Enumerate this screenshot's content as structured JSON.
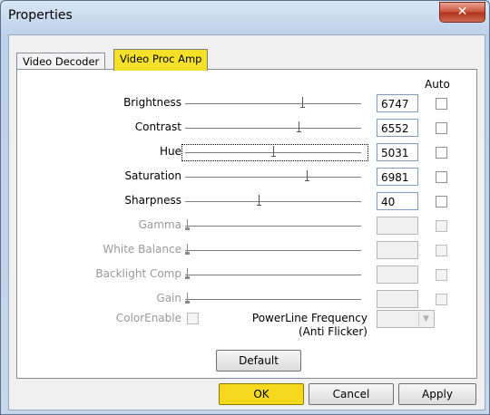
{
  "window": {
    "title": "Properties",
    "close_glyph": "✕"
  },
  "tabs": [
    {
      "label": "Video Decoder"
    },
    {
      "label": "Video Proc Amp"
    }
  ],
  "auto_header": "Auto",
  "properties": [
    {
      "label": "Brightness",
      "value": "6747",
      "slider_pct": 0.67,
      "enabled": true
    },
    {
      "label": "Contrast",
      "value": "6552",
      "slider_pct": 0.65,
      "enabled": true
    },
    {
      "label": "Hue",
      "value": "5031",
      "slider_pct": 0.5,
      "enabled": true,
      "focused": true
    },
    {
      "label": "Saturation",
      "value": "6981",
      "slider_pct": 0.7,
      "enabled": true
    },
    {
      "label": "Sharpness",
      "value": "40",
      "slider_pct": 0.42,
      "enabled": true
    },
    {
      "label": "Gamma",
      "value": "",
      "slider_pct": 0.0,
      "enabled": false
    },
    {
      "label": "White Balance",
      "value": "",
      "slider_pct": 0.0,
      "enabled": false
    },
    {
      "label": "Backlight Comp",
      "value": "",
      "slider_pct": 0.0,
      "enabled": false
    },
    {
      "label": "Gain",
      "value": "",
      "slider_pct": 0.0,
      "enabled": false
    }
  ],
  "color_enable": {
    "label": "ColorEnable"
  },
  "powerline": {
    "label_line1": "PowerLine Frequency",
    "label_line2": "(Anti Flicker)",
    "value": ""
  },
  "buttons": {
    "default": "Default",
    "ok": "OK",
    "cancel": "Cancel",
    "apply": "Apply"
  }
}
